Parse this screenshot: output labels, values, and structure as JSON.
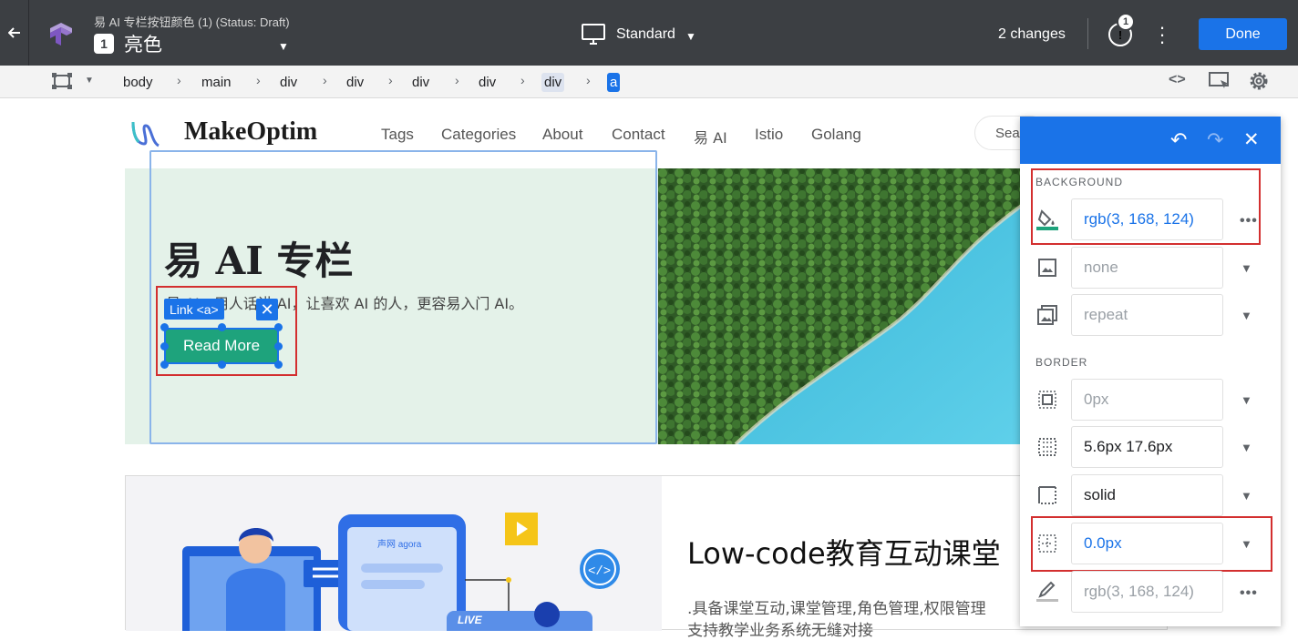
{
  "topbar": {
    "back_icon": "arrow-left-icon",
    "experiment_subtitle": "易 AI 专栏按钮颜色 (1) (Status: Draft)",
    "variant_number": "1",
    "variant_name": "亮色",
    "device_label": "Standard",
    "changes_label": "2 changes",
    "notification_count": "1",
    "done_label": "Done"
  },
  "breadcrumb": {
    "items": [
      "body",
      "main",
      "div",
      "div",
      "div",
      "div",
      "div",
      "a"
    ]
  },
  "site": {
    "brand": "MakeOptim",
    "nav": [
      "Tags",
      "Categories",
      "About",
      "Contact",
      "易 AI",
      "Istio",
      "Golang"
    ],
    "search_placeholder": "Sea",
    "hero_title": "易 AI 专栏",
    "hero_desc": "易 AI，用人话讲 AI，让喜欢 AI 的人，更容易入门 AI。",
    "read_more": "Read More",
    "link_tag": "Link <a>",
    "card2_title": "Low-code教育互动课堂",
    "card2_desc": ".具备课堂互动,课堂管理,角色管理,权限管理",
    "card2_desc2": "支持教学业务系统无缝对接",
    "card2_screen_brand": "声网 agora",
    "card2_live": "LIVE"
  },
  "panel": {
    "background_label": "BACKGROUND",
    "bg_color": "rgb(3, 168, 124)",
    "bg_image": "none",
    "bg_repeat": "repeat",
    "border_label": "BORDER",
    "border_width": "0px",
    "padding": "5.6px 17.6px",
    "border_style": "solid",
    "border_radius": "0.0px",
    "border_color": "rgb(3, 168, 124)"
  },
  "colors": {
    "accent": "#1a73e8",
    "button_green": "#1ea37c",
    "topbar": "#3c3f43",
    "highlight_red": "#d32f2f"
  }
}
